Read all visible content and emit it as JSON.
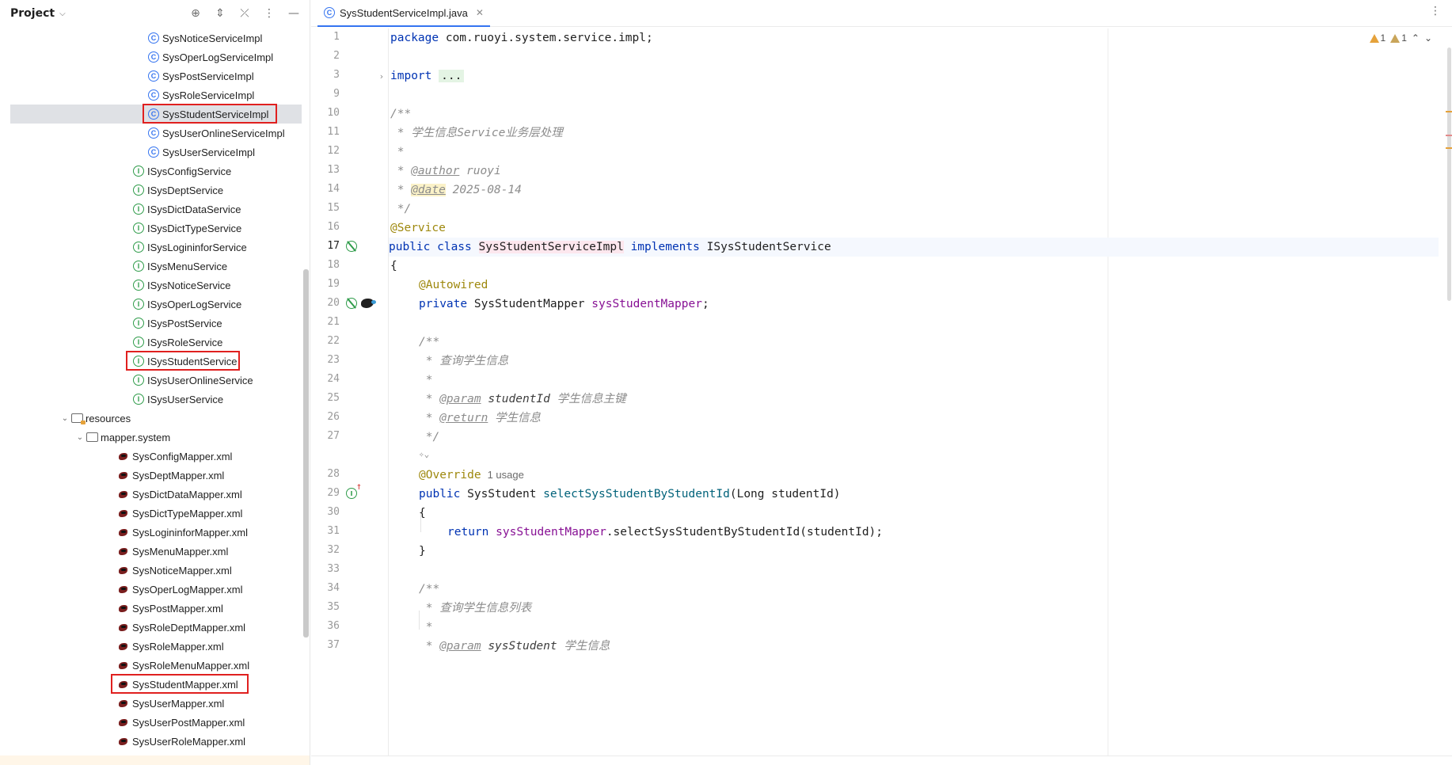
{
  "project_panel": {
    "title": "Project",
    "tree": [
      {
        "label": "SysNoticeServiceImpl",
        "icon": "class-icon"
      },
      {
        "label": "SysOperLogServiceImpl",
        "icon": "class-icon"
      },
      {
        "label": "SysPostServiceImpl",
        "icon": "class-icon"
      },
      {
        "label": "SysRoleServiceImpl",
        "icon": "class-icon"
      },
      {
        "label": "SysStudentServiceImpl",
        "icon": "class-icon",
        "selected": true
      },
      {
        "label": "SysUserOnlineServiceImpl",
        "icon": "class-icon"
      },
      {
        "label": "SysUserServiceImpl",
        "icon": "class-icon"
      },
      {
        "label": "ISysConfigService",
        "icon": "interface-icon"
      },
      {
        "label": "ISysDeptService",
        "icon": "interface-icon"
      },
      {
        "label": "ISysDictDataService",
        "icon": "interface-icon"
      },
      {
        "label": "ISysDictTypeService",
        "icon": "interface-icon"
      },
      {
        "label": "ISysLogininforService",
        "icon": "interface-icon"
      },
      {
        "label": "ISysMenuService",
        "icon": "interface-icon"
      },
      {
        "label": "ISysNoticeService",
        "icon": "interface-icon"
      },
      {
        "label": "ISysOperLogService",
        "icon": "interface-icon"
      },
      {
        "label": "ISysPostService",
        "icon": "interface-icon"
      },
      {
        "label": "ISysRoleService",
        "icon": "interface-icon"
      },
      {
        "label": "ISysStudentService",
        "icon": "interface-icon"
      },
      {
        "label": "ISysUserOnlineService",
        "icon": "interface-icon"
      },
      {
        "label": "ISysUserService",
        "icon": "interface-icon"
      },
      {
        "label": "resources",
        "icon": "resources-folder-icon"
      },
      {
        "label": "mapper.system",
        "icon": "folder-icon"
      },
      {
        "label": "SysConfigMapper.xml",
        "icon": "mybatis-xml-icon"
      },
      {
        "label": "SysDeptMapper.xml",
        "icon": "mybatis-xml-icon"
      },
      {
        "label": "SysDictDataMapper.xml",
        "icon": "mybatis-xml-icon"
      },
      {
        "label": "SysDictTypeMapper.xml",
        "icon": "mybatis-xml-icon"
      },
      {
        "label": "SysLogininforMapper.xml",
        "icon": "mybatis-xml-icon"
      },
      {
        "label": "SysMenuMapper.xml",
        "icon": "mybatis-xml-icon"
      },
      {
        "label": "SysNoticeMapper.xml",
        "icon": "mybatis-xml-icon"
      },
      {
        "label": "SysOperLogMapper.xml",
        "icon": "mybatis-xml-icon"
      },
      {
        "label": "SysPostMapper.xml",
        "icon": "mybatis-xml-icon"
      },
      {
        "label": "SysRoleDeptMapper.xml",
        "icon": "mybatis-xml-icon"
      },
      {
        "label": "SysRoleMapper.xml",
        "icon": "mybatis-xml-icon"
      },
      {
        "label": "SysRoleMenuMapper.xml",
        "icon": "mybatis-xml-icon"
      },
      {
        "label": "SysStudentMapper.xml",
        "icon": "mybatis-xml-icon"
      },
      {
        "label": "SysUserMapper.xml",
        "icon": "mybatis-xml-icon"
      },
      {
        "label": "SysUserPostMapper.xml",
        "icon": "mybatis-xml-icon"
      },
      {
        "label": "SysUserRoleMapper.xml",
        "icon": "mybatis-xml-icon"
      }
    ]
  },
  "editor": {
    "tab_label": "SysStudentServiceImpl.java",
    "warnings_count": "1",
    "weak_warnings_count": "1",
    "line_numbers": [
      "1",
      "2",
      "3",
      "9",
      "10",
      "11",
      "12",
      "13",
      "14",
      "15",
      "16",
      "17",
      "18",
      "19",
      "20",
      "21",
      "22",
      "23",
      "24",
      "25",
      "26",
      "27",
      "",
      "28",
      "29",
      "30",
      "31",
      "32",
      "33",
      "34",
      "35",
      "36",
      "37"
    ],
    "code": {
      "package_kw": "package",
      "package_name": " com.ruoyi.system.service.impl;",
      "import_kw": "import",
      "import_fold": "...",
      "doc_open": "/**",
      "doc_line1": " * 学生信息Service业务层处理",
      "doc_star": " *",
      "author_prefix": " * ",
      "author_tag": "@author",
      "author_value": " ruoyi",
      "date_prefix": " * ",
      "date_tag": "@date",
      "date_value": " 2025-08-14",
      "doc_close": " */",
      "service_ann": "@Service",
      "class_kw": "public class",
      "class_name": "SysStudentServiceImpl",
      "implements_kw": "implements",
      "iface_name": " ISysStudentService",
      "brace_open": "{",
      "autowired_ann": "@Autowired",
      "private_kw": "private",
      "mapper_type": " SysStudentMapper ",
      "mapper_field": "sysStudentMapper",
      "semicolon": ";",
      "m_doc_open": "/**",
      "m_doc_line1": " * 查询学生信息",
      "m_doc_star": " *",
      "param_prefix": " * ",
      "param_tag": "@param",
      "param_name": " studentId",
      "param_desc": " 学生信息主键",
      "return_prefix": " * ",
      "return_tag": "@return",
      "return_desc": " 学生信息",
      "m_doc_close": " */",
      "override_ann": "@Override",
      "usage_hint": "1 usage",
      "public_kw": "public",
      "ret_type": " SysStudent ",
      "method_name": "selectSysStudentByStudentId",
      "method_params": "(Long studentId)",
      "body_open": "{",
      "return_kw": "return",
      "call_field": "sysStudentMapper",
      "call_rest": ".selectSysStudentByStudentId(studentId);",
      "body_close": "}",
      "l_doc_open": "/**",
      "l_doc_line1": " * 查询学生信息列表",
      "l_doc_star": " *",
      "l_param_prefix": " * ",
      "l_param_tag": "@param",
      "l_param_name": " sysStudent",
      "l_param_desc": " 学生信息"
    }
  },
  "colors": {
    "keyword": "#0033b3",
    "annotation": "#9e880d",
    "field": "#871094",
    "method": "#00627a",
    "comment": "#8c8c8c",
    "highlight_box": "#e0201f",
    "selection": "#dfe1e5",
    "accent": "#3574f0"
  }
}
